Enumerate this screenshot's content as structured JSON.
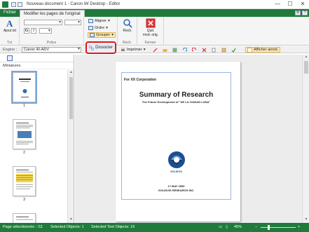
{
  "window": {
    "title": "Nouveau document 1 - Canon iW Desktop - Editor",
    "minimize": "—",
    "maximize": "☐",
    "close": "✕"
  },
  "tabs": {
    "file": "Fichier",
    "active": "Modifier les pages de l'original"
  },
  "ribbon": {
    "text_group": {
      "button": "Ajout txt",
      "label": "Txt"
    },
    "font_group": {
      "label": "Police",
      "bold": "G",
      "italic": "I"
    },
    "arrange_group": {
      "align": "Aligner",
      "order": "Ordre",
      "group": "Grouper"
    },
    "search_group": {
      "button": "Rech.",
      "label": "Rech."
    },
    "close_group": {
      "button_line1": "Quit.",
      "button_line2": "mod. orig.",
      "label": "Fermer"
    }
  },
  "toolbar": {
    "engine_label": "Engine :",
    "engine_value": "Canon iR-ADV",
    "dissocier": "Dissocier",
    "imprimer": "Imprimer",
    "afficher": "Afficher annot."
  },
  "sidebar": {
    "title": "Miniatures",
    "pages": [
      "1",
      "2",
      "3"
    ]
  },
  "document": {
    "for": "For XX Corporation",
    "title": "Summary of Research",
    "subtitle": "The Future Development of \"DE LA CIUDAD LUNA\"",
    "logo_text": "GOLDIVIS",
    "date": "17 MAY 2050",
    "company": "GOLDIVIS RESEARCH INC."
  },
  "status": {
    "pages_selected": "Page sélectionnée : /11",
    "selected_objects": "Selected Objects: 1",
    "selected_text_objects": "Selected Text Objects: 16",
    "zoom": "45%"
  },
  "colors": {
    "brand_green": "#1f7a3c",
    "highlight_red": "#e01818"
  }
}
